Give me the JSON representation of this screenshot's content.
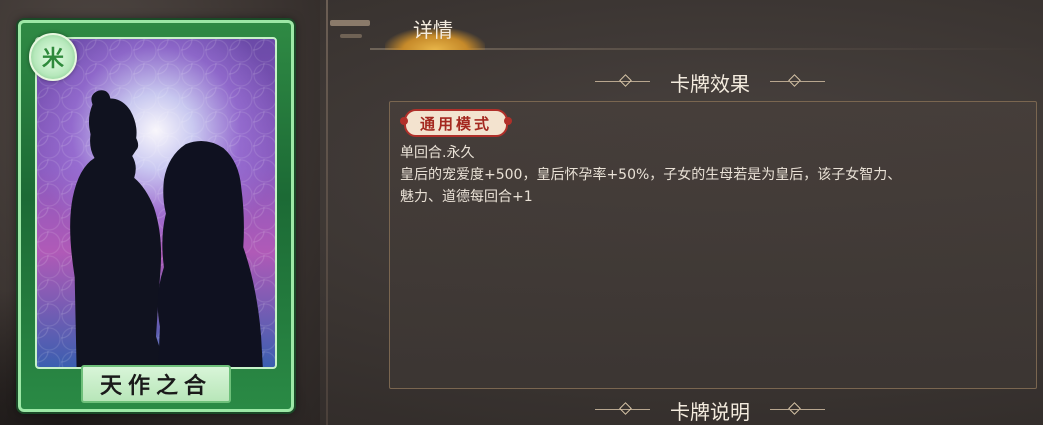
{
  "card": {
    "badge": "米",
    "name": "天作之合",
    "frame_color": "#2f8a44"
  },
  "tabs": [
    {
      "label": "详情",
      "active": true
    }
  ],
  "sections": {
    "effect_title": "卡牌效果",
    "description_title": "卡牌说明"
  },
  "effect": {
    "mode": "通用模式",
    "lines": [
      "单回合.永久",
      "皇后的宠爱度+500，皇后怀孕率+50%，子女的生母若是为皇后，该子女智力、",
      "魅力、道德每回合+1"
    ]
  },
  "icons": [
    "badge-icon",
    "diamond-icon"
  ]
}
